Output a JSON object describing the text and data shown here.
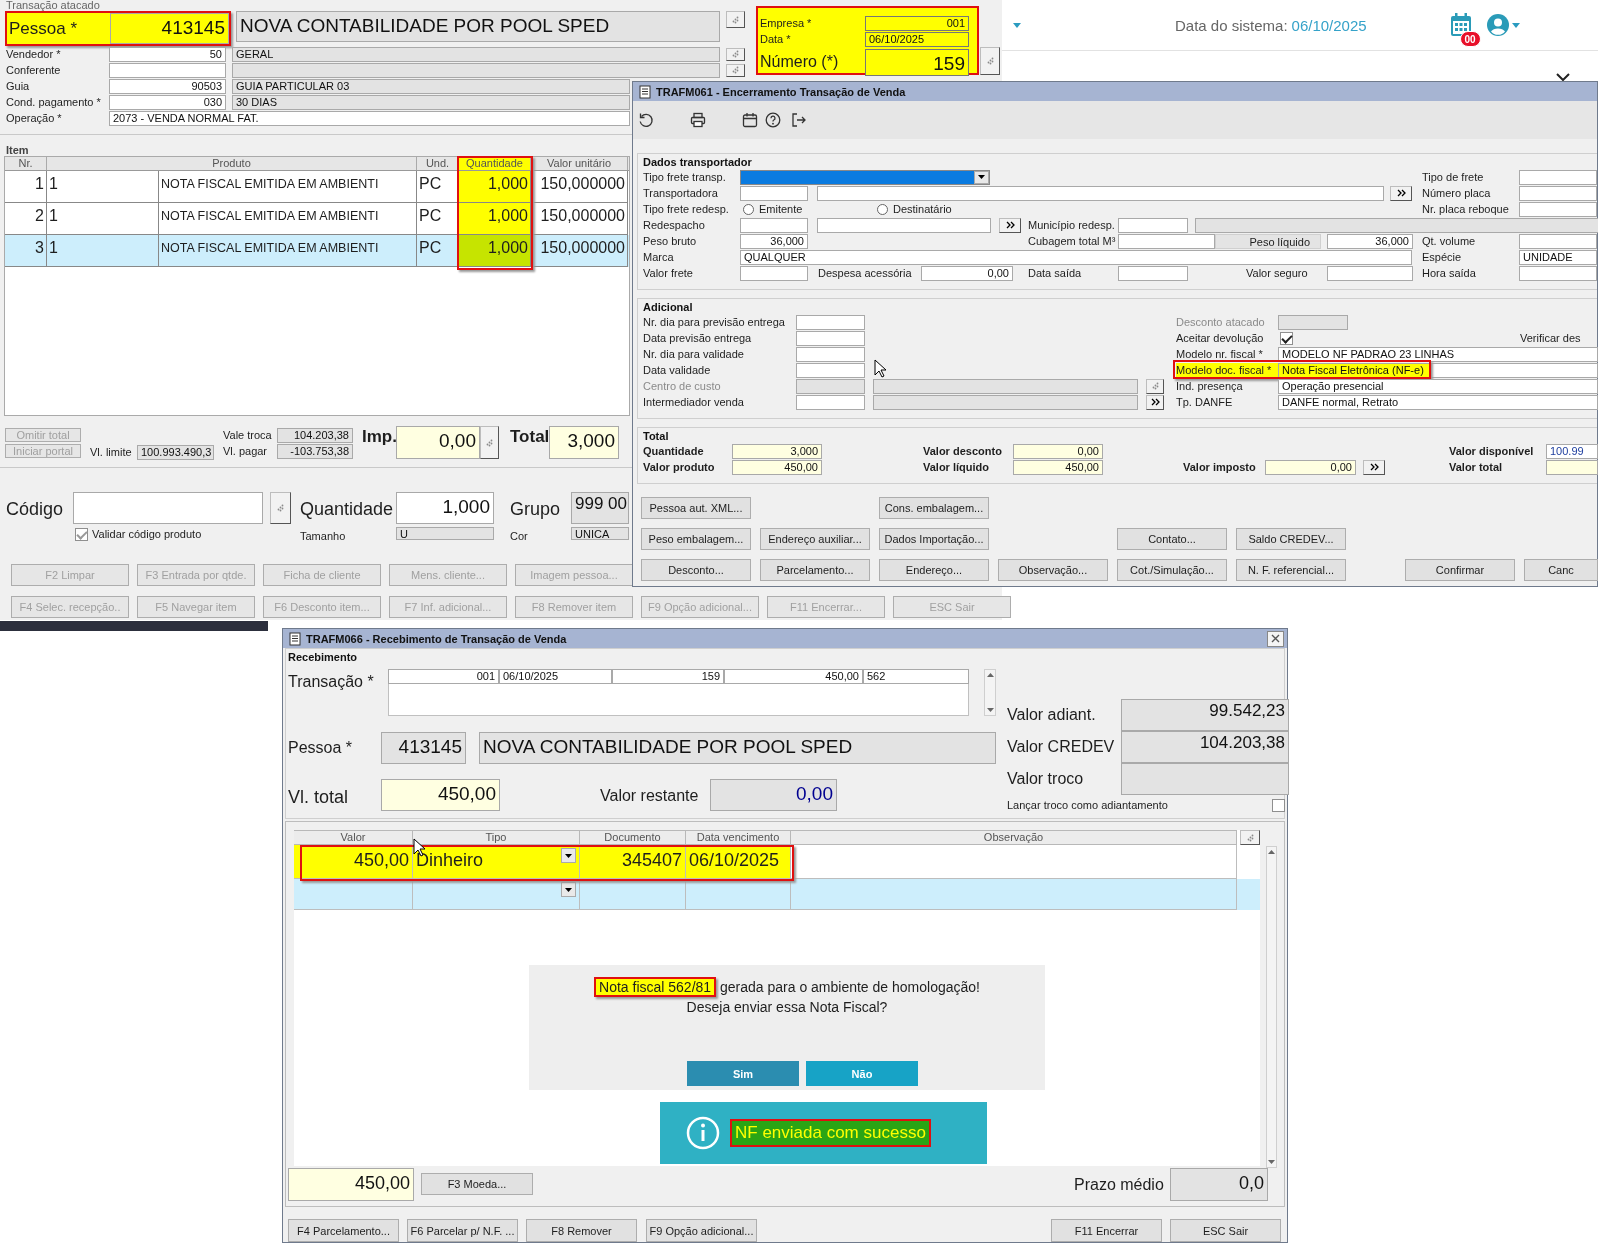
{
  "back_window": {
    "section": "Transação atacado",
    "pessoa": {
      "label": "Pessoa *",
      "code": "413145",
      "name": "NOVA CONTABILIDADE POR POOL SPED",
      "highlighted": true
    },
    "rows": [
      {
        "label": "Vendedor *",
        "code": "50",
        "description": "GERAL"
      },
      {
        "label": "Conferente"
      },
      {
        "label": "Guia",
        "code": "90503",
        "description": "GUIA PARTICULAR 03"
      },
      {
        "label": "Cond. pagamento *",
        "code": "030",
        "description": "30 DIAS"
      }
    ],
    "operacao": {
      "label": "Operação *",
      "value": "2073 - VENDA NORMAL FAT."
    },
    "header_box": {
      "highlighted": true,
      "fields": [
        {
          "label": "Empresa *",
          "value": "001",
          "kind": "small"
        },
        {
          "label": "Data *",
          "value": "06/10/2025",
          "kind": "small"
        },
        {
          "label": "Número (*)",
          "value": "159",
          "kind": "large"
        }
      ]
    },
    "item_section": "Item",
    "table": {
      "columns": [
        {
          "label": "Nr.",
          "highlighted": false
        },
        {
          "label": "Produto",
          "highlighted": false
        },
        {
          "label": "Und.",
          "highlighted": false
        },
        {
          "label": "Quantidade",
          "highlighted": true
        },
        {
          "label": "Valor unitário",
          "highlighted": false
        }
      ],
      "rows": [
        {
          "nr": "1",
          "code": "1",
          "description": "NOTA FISCAL EMITIDA EM AMBIENTI",
          "unit": "PC",
          "quantity": "1,000",
          "unit_price": "150,000000",
          "selected": false
        },
        {
          "nr": "2",
          "code": "1",
          "description": "NOTA FISCAL EMITIDA EM AMBIENTI",
          "unit": "PC",
          "quantity": "1,000",
          "unit_price": "150,000000",
          "selected": false
        },
        {
          "nr": "3",
          "code": "1",
          "description": "NOTA FISCAL EMITIDA EM AMBIENTI",
          "unit": "PC",
          "quantity": "1,000",
          "unit_price": "150,000000",
          "selected": true
        }
      ]
    },
    "summary": {
      "buttons": [
        {
          "label": "Omitir total",
          "disabled": true
        },
        {
          "label": "Iniciar portal",
          "disabled": true
        }
      ],
      "limite_label": "Vl. limite",
      "limite": "100.993.490,3",
      "vale_troca_label": "Vale troca",
      "vale_troca": "104.203,38",
      "pagar_label": "Vl. pagar",
      "pagar": "-103.753,38",
      "imp_label": "Imp.",
      "imp": "0,00",
      "total_label": "Total",
      "total": "3,000"
    },
    "entry": {
      "codigo_label": "Código",
      "validar": {
        "label": "Validar código produto",
        "checked": true
      },
      "quantidade_label": "Quantidade",
      "quantidade": "1,000",
      "tamanho_label": "Tamanho",
      "tamanho": "U",
      "grupo_label": "Grupo",
      "grupo": "999 00",
      "cor_label": "Cor",
      "cor": "UNICA"
    },
    "buttons": [
      [
        {
          "label": "F2 Limpar",
          "disabled": true
        },
        {
          "label": "F3 Entrada por qtde.",
          "disabled": true
        },
        {
          "label": "Ficha de cliente",
          "disabled": true
        },
        {
          "label": "Mens. cliente...",
          "disabled": true
        },
        {
          "label": "Imagem pessoa...",
          "disabled": true
        }
      ],
      [
        {
          "label": "F4 Selec. recepção..",
          "disabled": true
        },
        {
          "label": "F5 Navegar item",
          "disabled": true
        },
        {
          "label": "F6 Desconto item...",
          "disabled": true
        },
        {
          "label": "F7 Inf. adicional...",
          "disabled": true
        },
        {
          "label": "F8 Remover item",
          "disabled": true
        },
        {
          "label": "F9 Opção adicional...",
          "disabled": true
        },
        {
          "label": "F11 Encerrar...",
          "disabled": true
        },
        {
          "label": "ESC Sair",
          "disabled": true
        }
      ]
    ]
  },
  "web_header": {
    "label": "Data do sistema:",
    "date": "06/10/2025",
    "badge": "00"
  },
  "closing_window": {
    "title": "TRAFM061 - Encerramento Transação de Venda",
    "transport": {
      "title": "Dados transportador",
      "tipo_frete_transp": {
        "label": "Tipo frete transp."
      },
      "transportadora": {
        "label": "Transportadora"
      },
      "tipo_frete_redesp": {
        "label": "Tipo frete redesp.",
        "options": [
          {
            "label": "Emitente",
            "selected": false
          },
          {
            "label": "Destinatário",
            "selected": false
          }
        ]
      },
      "redespacho": {
        "label": "Redespacho"
      },
      "municipio_redesp": {
        "label": "Município redesp."
      },
      "peso_bruto": {
        "label": "Peso bruto",
        "value": "36,000"
      },
      "cubagem": {
        "label": "Cubagem total M³"
      },
      "peso_liquido": {
        "label": "Peso líquido",
        "value": "36,000"
      },
      "marca": {
        "label": "Marca",
        "value": "QUALQUER"
      },
      "valor_frete": {
        "label": "Valor frete"
      },
      "despesa": {
        "label": "Despesa acessória",
        "value": "0,00"
      },
      "data_saida": {
        "label": "Data saída"
      },
      "valor_seguro": {
        "label": "Valor seguro"
      },
      "right": [
        {
          "label": "Tipo de frete"
        },
        {
          "label": "Número placa"
        },
        {
          "label": "Nr. placa reboque"
        },
        {
          "label": "Qt. volume"
        },
        {
          "label": "Espécie",
          "value": "UNIDADE"
        },
        {
          "label": "Hora saída"
        }
      ]
    },
    "additional": {
      "title": "Adicional",
      "left": [
        {
          "label": "Nr. dia para previsão entrega",
          "disabled": false
        },
        {
          "label": "Data previsão entrega",
          "disabled": false
        },
        {
          "label": "Nr. dia para validade",
          "disabled": false
        },
        {
          "label": "Data validade",
          "disabled": false
        },
        {
          "label": "Centro de custo",
          "disabled": true
        },
        {
          "label": "Intermediador venda",
          "disabled": false
        }
      ],
      "right": [
        {
          "label": "Desconto atacado",
          "kind": "field",
          "disabled": true,
          "highlighted": false
        },
        {
          "label": "Aceitar devolução",
          "kind": "checkbox",
          "checked": true,
          "disabled": false,
          "highlighted": false
        },
        {
          "label": "Modelo nr. fiscal *",
          "kind": "text",
          "value": "MODELO NF PADRAO 23 LINHAS",
          "disabled": false,
          "highlighted": false
        },
        {
          "label": "Modelo doc. fiscal *",
          "kind": "text",
          "value": "Nota Fiscal Eletrônica (NF-e)",
          "disabled": false,
          "highlighted": true
        },
        {
          "label": "Ind. presença",
          "kind": "text",
          "value": "Operação presencial",
          "disabled": false,
          "highlighted": false
        },
        {
          "label": "Tp. DANFE",
          "kind": "text",
          "value": "DANFE normal, Retrato",
          "disabled": false,
          "highlighted": false
        }
      ],
      "verificar": "Verificar des"
    },
    "totals": {
      "title": "Total",
      "items": [
        {
          "label": "Quantidade",
          "value": "3,000"
        },
        {
          "label": "Valor desconto",
          "value": "0,00"
        },
        {
          "label": "Valor disponível",
          "value": "100.99"
        },
        {
          "label": "Valor produto",
          "value": "450,00"
        },
        {
          "label": "Valor líquido",
          "value": "450,00"
        },
        {
          "label": "Valor imposto",
          "value": "0,00"
        },
        {
          "label": "Valor total"
        }
      ]
    },
    "buttons": [
      [
        {
          "label": "Pessoa aut. XML..."
        },
        {
          "label": "Cons. embalagem..."
        }
      ],
      [
        {
          "label": "Peso embalagem..."
        },
        {
          "label": "Endereço auxiliar..."
        },
        {
          "label": "Dados Importação..."
        },
        {
          "label": "Contato..."
        },
        {
          "label": "Saldo CREDEV..."
        }
      ],
      [
        {
          "label": "Desconto..."
        },
        {
          "label": "Parcelamento..."
        },
        {
          "label": "Endereço..."
        },
        {
          "label": "Observação..."
        },
        {
          "label": "Cot./Simulação..."
        },
        {
          "label": "N. F. referencial..."
        },
        {
          "label": "Confirmar"
        },
        {
          "label": "Canc"
        }
      ]
    ]
  },
  "receive_window": {
    "title": "TRAFM066 - Recebimento de Transação de Venda",
    "section": "Recebimento",
    "transacao": {
      "label": "Transação *",
      "values": [
        "001",
        "06/10/2025",
        "159",
        "450,00",
        "562"
      ]
    },
    "pessoa": {
      "label": "Pessoa *",
      "code": "413145",
      "name": "NOVA CONTABILIDADE POR POOL SPED"
    },
    "total": {
      "label": "Vl. total",
      "value": "450,00"
    },
    "restante": {
      "label": "Valor restante",
      "value": "0,00"
    },
    "side": [
      {
        "label": "Valor adiant.",
        "value": "99.542,23"
      },
      {
        "label": "Valor CREDEV",
        "value": "104.203,38"
      },
      {
        "label": "Valor troco"
      }
    ],
    "troco_checkbox": {
      "label": "Lançar troco como adiantamento",
      "checked": false
    },
    "grid": {
      "columns": [
        "Valor",
        "Tipo",
        "Documento",
        "Data vencimento",
        "Observação"
      ],
      "rows": [
        {
          "valor": "450,00",
          "tipo": "Dinheiro",
          "documento": "345407",
          "vencimento": "06/10/2025",
          "selected": false,
          "highlighted": true
        },
        {
          "selected": true,
          "highlighted": false
        }
      ]
    },
    "dialog": {
      "message": [
        {
          "text": "Nota fiscal 562/81",
          "highlighted": true
        },
        {
          "text": " gerada para o ambiente de homologação!",
          "highlighted": false
        }
      ],
      "question": "Deseja enviar essa Nota Fiscal?",
      "buttons": [
        {
          "label": "Sim"
        },
        {
          "label": "Não"
        }
      ]
    },
    "toast": {
      "text": "NF enviada com sucesso",
      "highlighted": true
    },
    "footer": {
      "value": "450,00",
      "moeda": {
        "label": "F3 Moeda..."
      },
      "prazo_label": "Prazo médio",
      "prazo": "0,0"
    },
    "buttons": [
      {
        "label": "F4 Parcelamento..."
      },
      {
        "label": "F6 Parcelar p/ N.F. ..."
      },
      {
        "label": "F8 Remover"
      },
      {
        "label": "F9 Opção adicional..."
      },
      {
        "label": "F11 Encerrar"
      },
      {
        "label": "ESC Sair"
      }
    ]
  }
}
